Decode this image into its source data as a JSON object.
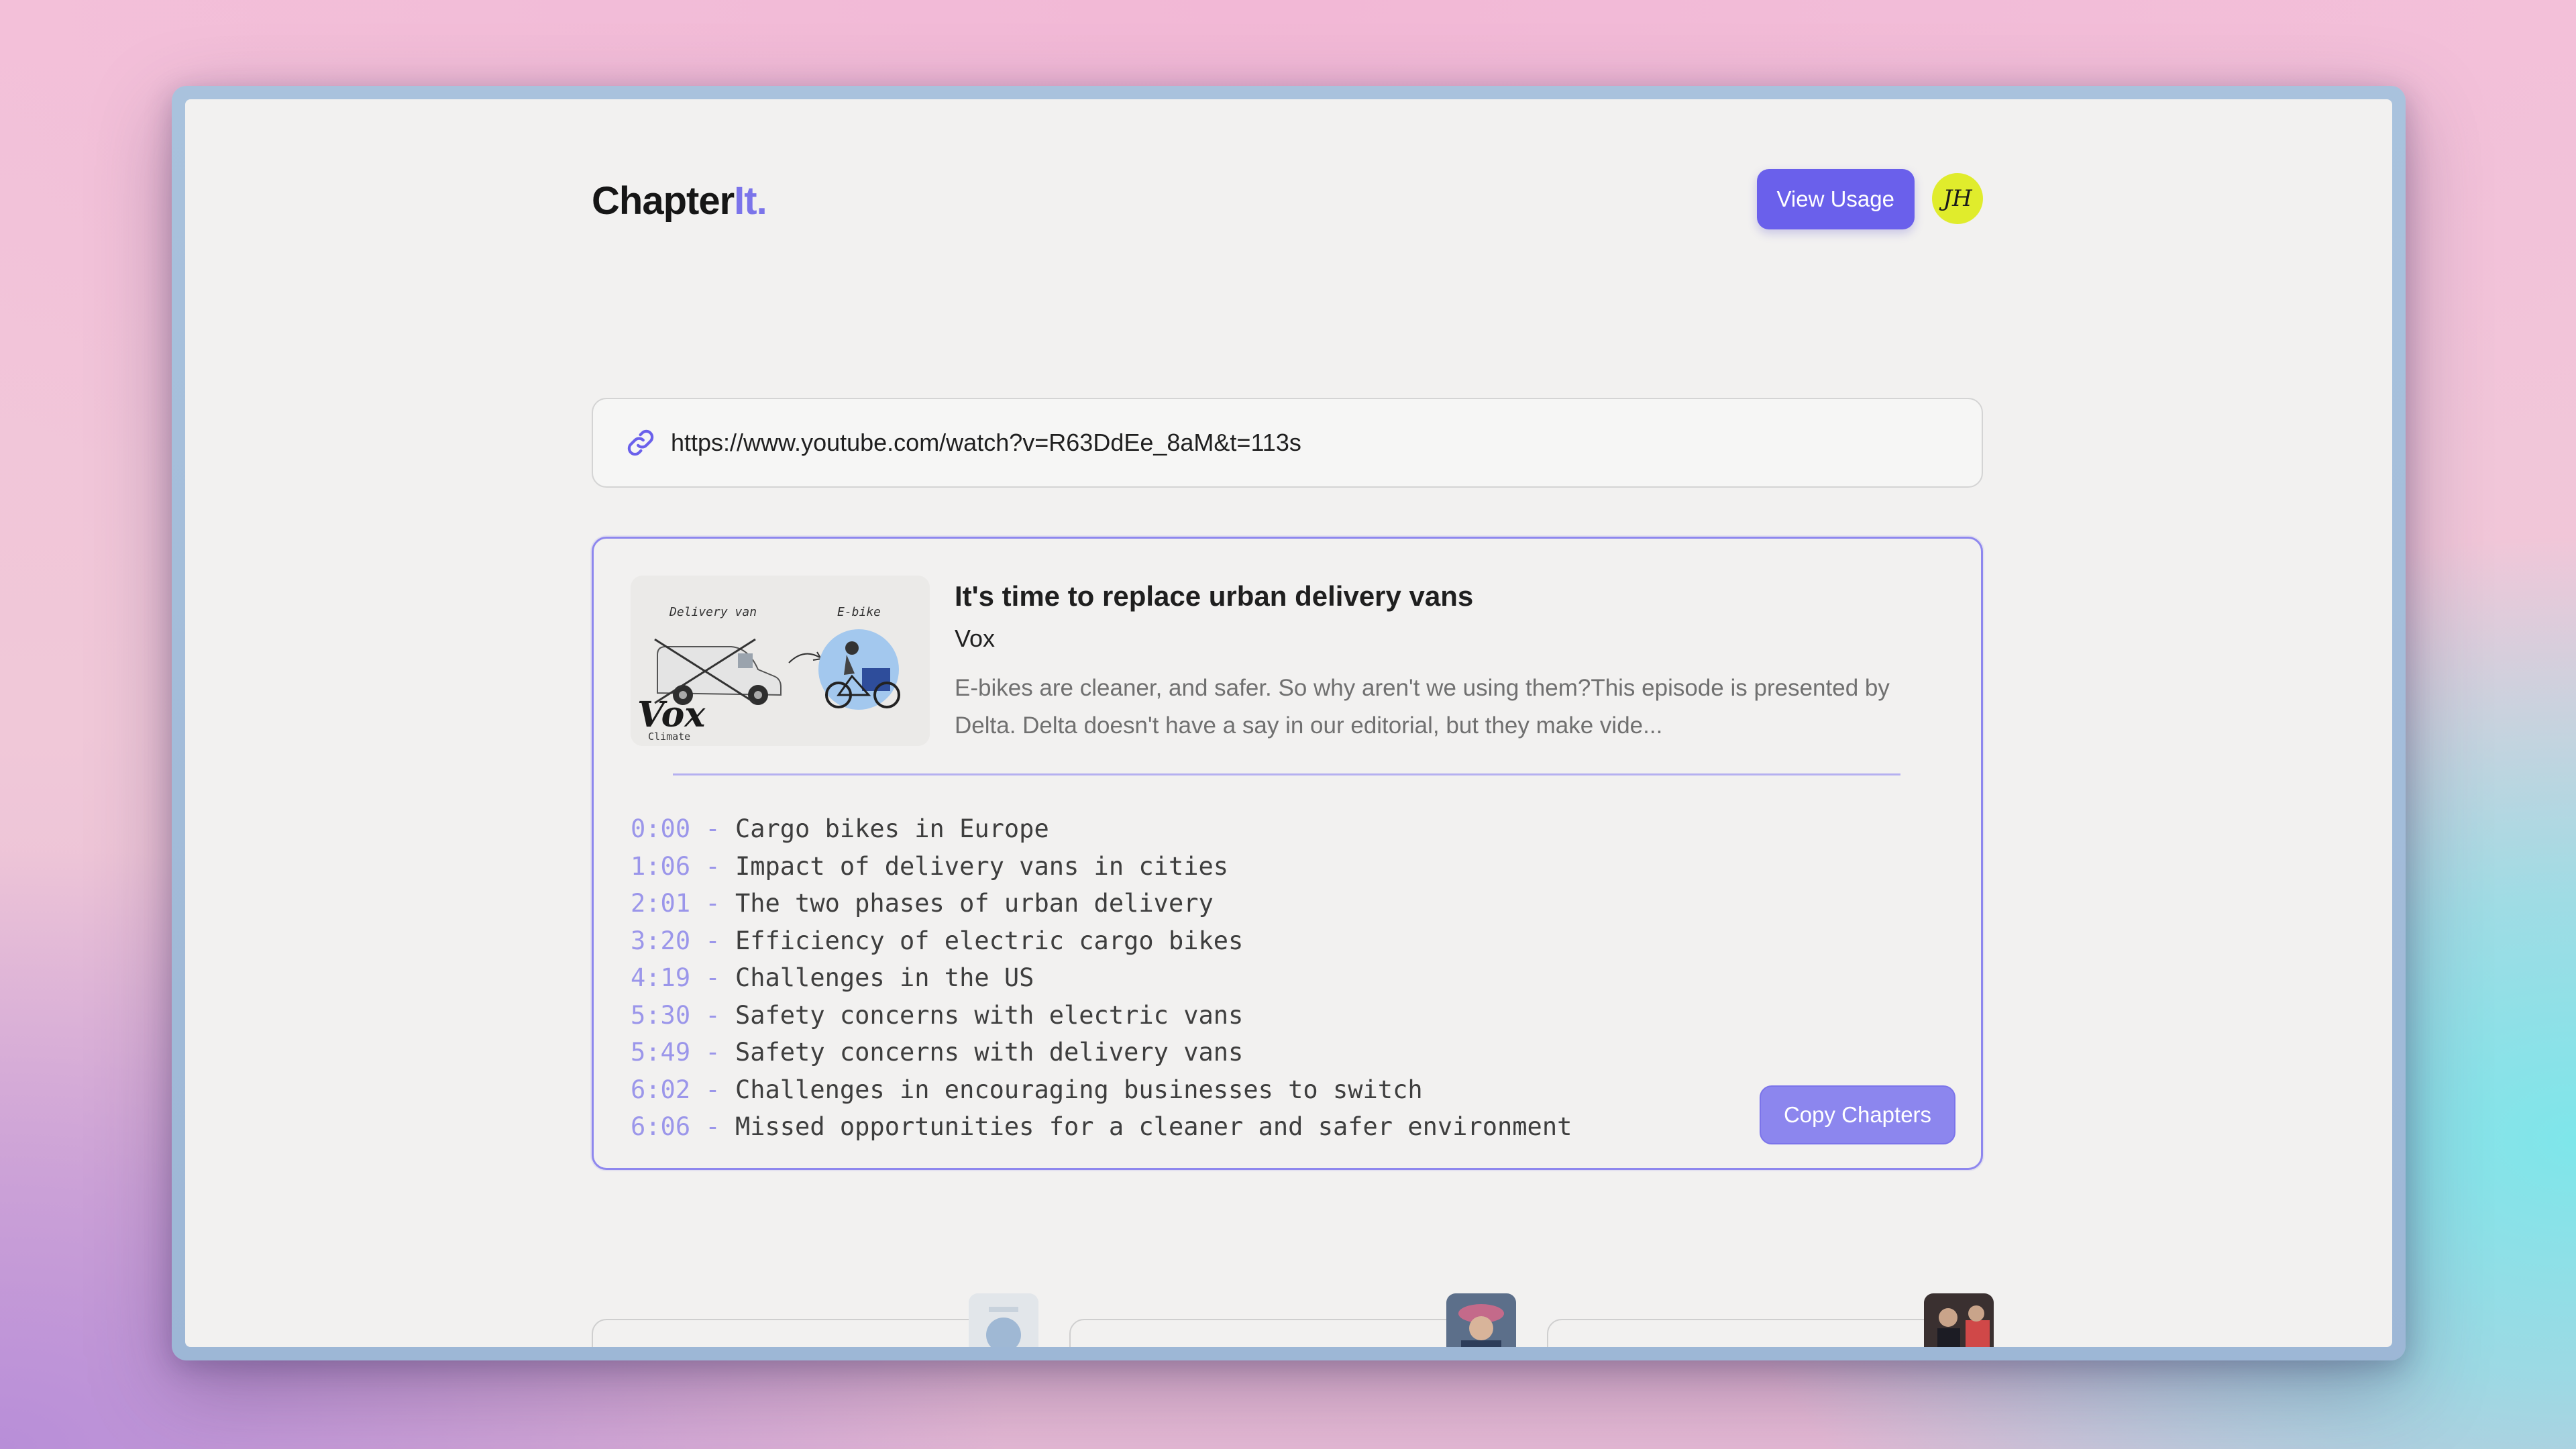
{
  "app": {
    "logo_main": "Chapter",
    "logo_accent": "It."
  },
  "header": {
    "usage_button": "View Usage",
    "avatar_initials": "JH"
  },
  "url_input": {
    "value": "https://www.youtube.com/watch?v=R63DdEe_8aM&t=113s",
    "icon": "link-icon"
  },
  "video": {
    "title": "It's time to replace urban delivery vans",
    "channel": "Vox",
    "description": "E-bikes are cleaner, and safer. So why aren't we using them?This episode is presented by Delta. Delta doesn't have a say in our editorial, but they make vide...",
    "thumbnail": {
      "label_left": "Delivery van",
      "label_right": "E-bike",
      "brand": "Vox",
      "brand_sub": "Climate"
    }
  },
  "chapters": [
    {
      "time": "0:00",
      "label": "Cargo bikes in Europe"
    },
    {
      "time": "1:06",
      "label": "Impact of delivery vans in cities"
    },
    {
      "time": "2:01",
      "label": "The two phases of urban delivery"
    },
    {
      "time": "3:20",
      "label": "Efficiency of electric cargo bikes"
    },
    {
      "time": "4:19",
      "label": "Challenges in the US"
    },
    {
      "time": "5:30",
      "label": "Safety concerns with electric vans"
    },
    {
      "time": "5:49",
      "label": "Safety concerns with delivery vans"
    },
    {
      "time": "6:02",
      "label": "Challenges in encouraging businesses to switch"
    },
    {
      "time": "6:06",
      "label": "Missed opportunities for a cleaner and safer environment"
    }
  ],
  "chapter_separator": " - ",
  "copy_button": "Copy Chapters",
  "colors": {
    "accent": "#6a60eb",
    "accent_light": "#8c86ee",
    "avatar_bg": "#e0ec2c",
    "timestamp": "#9b96ea"
  }
}
